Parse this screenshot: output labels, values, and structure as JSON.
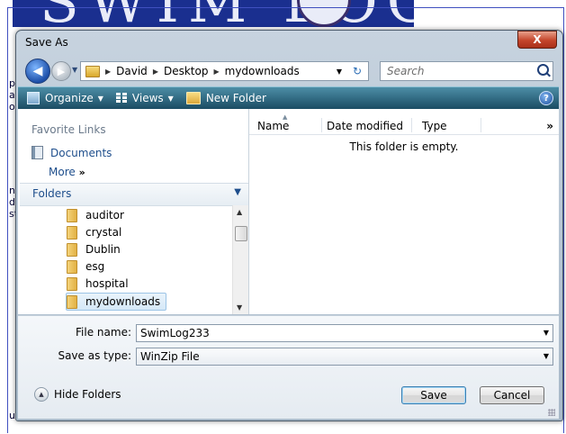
{
  "background": {
    "banner_text": "SWIM LOG",
    "fragments": [
      "pa",
      "ai",
      "o",
      "n",
      "dt",
      "st",
      "u"
    ]
  },
  "dialog": {
    "title": "Save As",
    "close_glyph": "X"
  },
  "nav": {
    "back_glyph": "◀",
    "forward_glyph": "▶",
    "breadcrumb": [
      "David",
      "Desktop",
      "mydownloads"
    ],
    "refresh_glyph": "↻",
    "search_placeholder": "Search"
  },
  "toolbar": {
    "organize": "Organize",
    "views": "Views",
    "new_folder": "New Folder",
    "help_glyph": "?"
  },
  "left_pane": {
    "favorites_header": "Favorite Links",
    "favorites": [
      {
        "label": "Documents",
        "icon": "documents-icon"
      }
    ],
    "more_label": "More",
    "more_glyph": "»",
    "folders_label": "Folders",
    "folders": [
      {
        "name": "auditor",
        "selected": false
      },
      {
        "name": "crystal",
        "selected": false
      },
      {
        "name": "Dublin",
        "selected": false
      },
      {
        "name": "esg",
        "selected": false
      },
      {
        "name": "hospital",
        "selected": false
      },
      {
        "name": "mydownloads",
        "selected": true
      }
    ]
  },
  "file_list": {
    "columns": [
      "Name",
      "Date modified",
      "Type"
    ],
    "more_glyph": "»",
    "empty_message": "This folder is empty."
  },
  "bottom": {
    "file_name_label": "File name:",
    "file_name_value": "SwimLog233",
    "save_type_label": "Save as type:",
    "save_type_value": "WinZip File",
    "hide_folders": "Hide Folders",
    "save_button": "Save",
    "cancel_button": "Cancel"
  }
}
